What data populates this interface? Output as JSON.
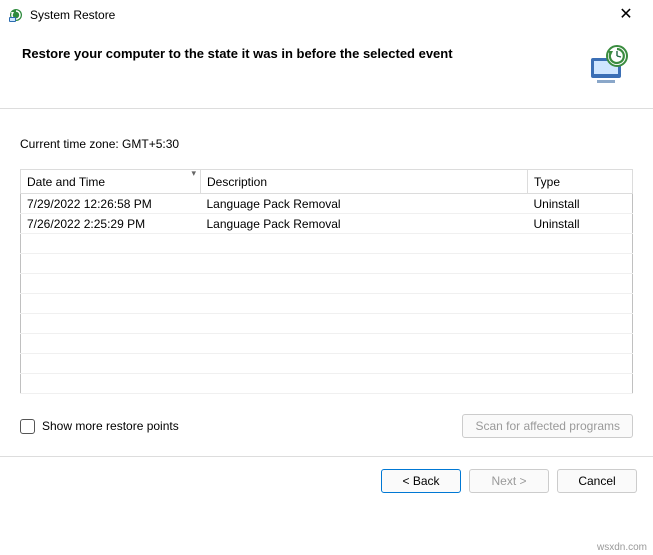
{
  "title": "System Restore",
  "heading": "Restore your computer to the state it was in before the selected event",
  "timezone_label": "Current time zone: GMT+5:30",
  "columns": {
    "date": "Date and Time",
    "desc": "Description",
    "type": "Type"
  },
  "rows": [
    {
      "date": "7/29/2022 12:26:58 PM",
      "desc": "Language Pack Removal",
      "type": "Uninstall"
    },
    {
      "date": "7/26/2022 2:25:29 PM",
      "desc": "Language Pack Removal",
      "type": "Uninstall"
    }
  ],
  "show_more_label": "Show more restore points",
  "scan_button": "Scan for affected programs",
  "buttons": {
    "back": "< Back",
    "next": "Next >",
    "cancel": "Cancel"
  },
  "watermark": "wsxdn.com"
}
